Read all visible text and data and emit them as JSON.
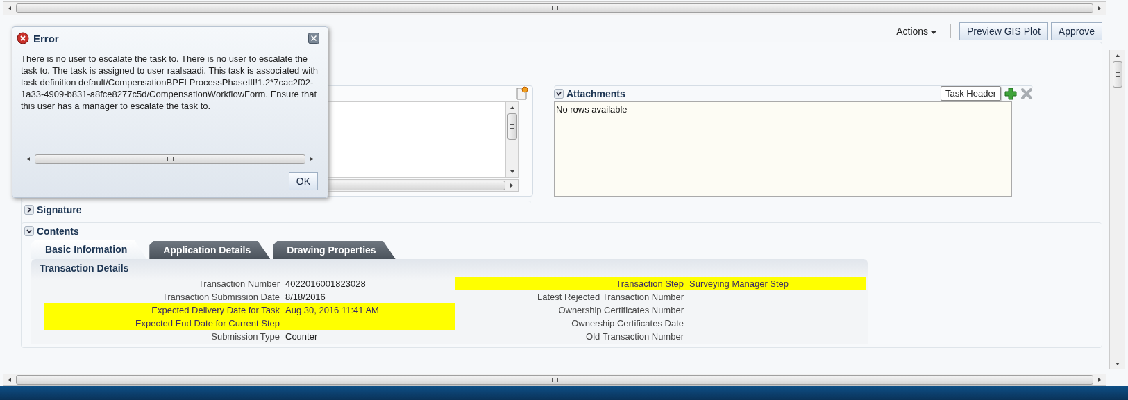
{
  "header": {
    "actions_menu": "Actions",
    "buttons": [
      {
        "label": "Preview GIS Plot"
      },
      {
        "label": "Approve"
      }
    ]
  },
  "attachments": {
    "title": "Attachments",
    "expanded": true,
    "empty_text": "No rows available",
    "tooltip": "Task Header"
  },
  "sections": [
    {
      "title": "Signature",
      "expanded": false
    },
    {
      "title": "Contents",
      "expanded": true
    }
  ],
  "tabs": [
    {
      "label": "Basic Information",
      "selected": true
    },
    {
      "label": "Application Details",
      "selected": false
    },
    {
      "label": "Drawing Properties",
      "selected": false
    }
  ],
  "transaction_details": {
    "title": "Transaction Details",
    "left_fields": [
      {
        "label": "Transaction Number",
        "value": "4022016001823028",
        "highlighted": false
      },
      {
        "label": "Transaction Submission Date",
        "value": "8/18/2016",
        "highlighted": false
      },
      {
        "label": "Expected Delivery Date for Task",
        "value": "Aug 30, 2016 11:41 AM",
        "highlighted": true
      },
      {
        "label": "Expected End Date for Current Step",
        "highlighted": true
      },
      {
        "label": "Submission Type",
        "value": "Counter",
        "highlighted": false
      }
    ],
    "right_fields": [
      {
        "label": "Transaction Step",
        "value": "Surveying Manager Step",
        "highlighted": true
      },
      {
        "label": "Latest Rejected Transaction Number",
        "highlighted": false
      },
      {
        "label": "Ownership Certificates Number",
        "highlighted": false
      },
      {
        "label": "Ownership Certificates Date",
        "highlighted": false
      },
      {
        "label": "Old Transaction Number",
        "highlighted": false
      }
    ]
  },
  "error_dialog": {
    "title": "Error",
    "message": "There is no user to escalate the task to. There is no user to escalate the task to. The task is assigned to user raalsaadi. This task is associated with task definition default/CompensationBPELProcessPhaseIII!1.2*7cac2f02-1a33-4909-b831-a8fce8277c5d/CompensationWorkflowForm. Ensure that this user has a manager to escalate the task to.",
    "button": "OK"
  }
}
